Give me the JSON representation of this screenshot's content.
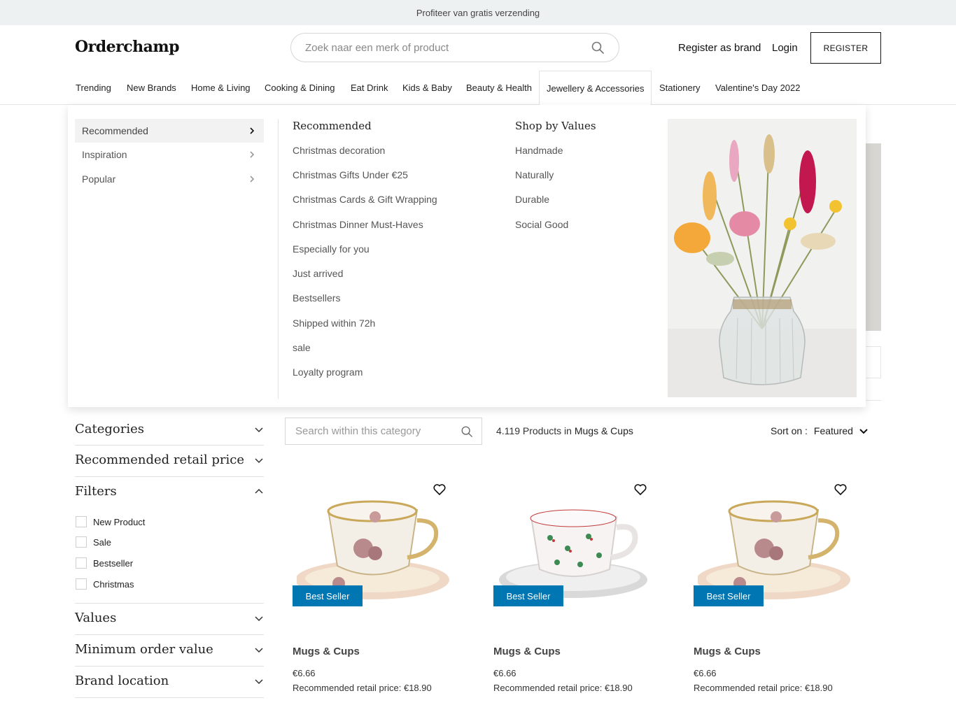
{
  "banner": {
    "text": "Profiteer van gratis verzending"
  },
  "header": {
    "logo": "Orderchamp",
    "search_placeholder": "Zoek naar een merk of product",
    "register_as_brand": "Register as brand",
    "login": "Login",
    "register": "REGISTER"
  },
  "nav": {
    "items": [
      "Trending",
      "New Brands",
      "Home & Living",
      "Cooking & Dining",
      "Eat Drink",
      "Kids & Baby",
      "Beauty & Health",
      "Jewellery & Accessories",
      "Stationery",
      "Valentine's Day 2022"
    ],
    "active": "Jewellery & Accessories"
  },
  "mega_menu": {
    "left": [
      "Recommended",
      "Inspiration",
      "Popular"
    ],
    "col1": {
      "title": "Recommended",
      "links": [
        "Christmas decoration",
        "Christmas Gifts Under €25",
        "Christmas Cards & Gift Wrapping",
        "Christmas Dinner Must-Haves",
        "Especially for you",
        "Just arrived",
        "Bestsellers",
        "Shipped within 72h",
        "sale",
        "Loyalty program"
      ]
    },
    "col2": {
      "title": "Shop by Values",
      "links": [
        "Handmade",
        "Naturally",
        "Durable",
        "Social Good"
      ]
    }
  },
  "sidebar": {
    "facets": [
      "Categories",
      "Recommended retail price",
      "Filters",
      "Values",
      "Minimum order value",
      "Brand location"
    ],
    "filters": [
      "New Product",
      "Sale",
      "Bestseller",
      "Christmas"
    ]
  },
  "listing": {
    "search_placeholder": "Search within this category",
    "count": "4.119",
    "count_mid": "Products in",
    "category": "Mugs & Cups",
    "sort_label": "Sort on :",
    "sort_value": "Featured"
  },
  "products": [
    {
      "badge": "Best Seller",
      "category": "Mugs & Cups",
      "price": "€6.66",
      "rrp": "Recommended retail price: €18.90"
    },
    {
      "badge": "Best Seller",
      "category": "Mugs & Cups",
      "price": "€6.66",
      "rrp": "Recommended retail price: €18.90"
    },
    {
      "badge": "Best Seller",
      "category": "Mugs & Cups",
      "price": "€6.66",
      "rrp": "Recommended retail price: €18.90"
    }
  ],
  "colors": {
    "accent": "#0076b3",
    "banner_bg": "#eef1f1"
  }
}
